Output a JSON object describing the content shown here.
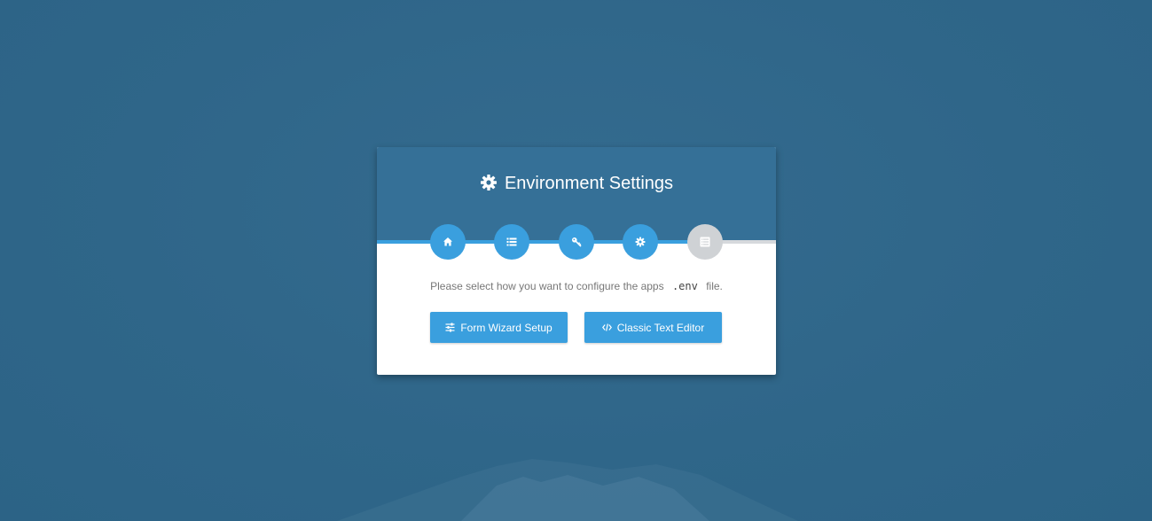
{
  "colors": {
    "background": "#2f6689",
    "header": "#357097",
    "accent": "#3a9fde",
    "inactive_step": "#cfd2d5"
  },
  "header": {
    "icon": "gear-icon",
    "title": "Environment Settings"
  },
  "steps": [
    {
      "icon": "home-icon",
      "state": "complete"
    },
    {
      "icon": "list-icon",
      "state": "complete"
    },
    {
      "icon": "key-icon",
      "state": "complete"
    },
    {
      "icon": "gear-icon",
      "state": "complete"
    },
    {
      "icon": "list-alt-icon",
      "state": "inactive"
    }
  ],
  "progress_fraction": 0.8,
  "message": {
    "before": "Please select how you want to configure the apps",
    "code": ".env",
    "after": "file."
  },
  "buttons": {
    "wizard": {
      "label": "Form Wizard Setup",
      "icon": "sliders-icon"
    },
    "editor": {
      "label": "Classic Text Editor",
      "icon": "code-icon"
    }
  }
}
